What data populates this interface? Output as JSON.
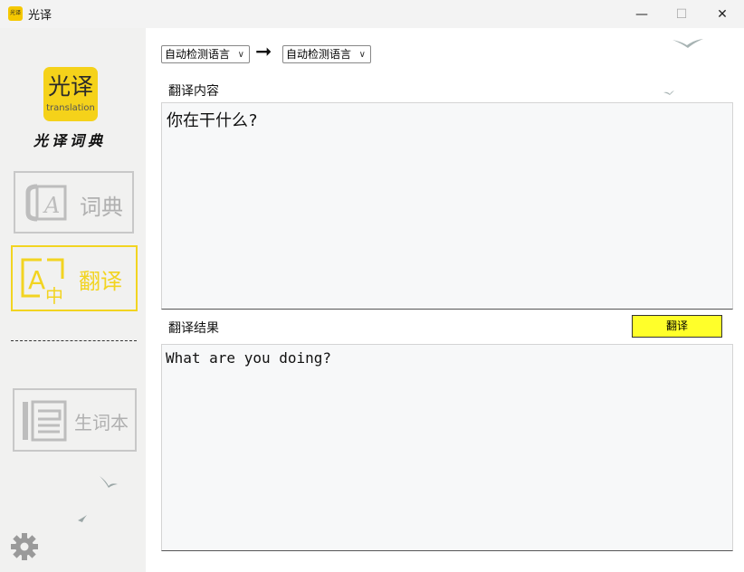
{
  "window": {
    "title": "光译",
    "app_icon_text": "光译",
    "minimize": "—",
    "maximize": "☐",
    "close": "✕"
  },
  "sidebar": {
    "logo_text": "光译",
    "logo_subtext": "translation",
    "brand": "光译词典",
    "nav": [
      {
        "label": "词典",
        "icon": "dictionary-icon",
        "active": false
      },
      {
        "label": "翻译",
        "icon": "translate-icon",
        "active": true
      },
      {
        "label": "生词本",
        "icon": "vocabulary-book-icon",
        "active": false
      }
    ],
    "settings_icon": "gear-icon"
  },
  "main": {
    "source_lang": "自动检测语言",
    "target_lang": "自动检测语言",
    "arrow_icon": "arrow-right-icon",
    "input_label": "翻译内容",
    "input_text": "你在干什么?",
    "output_label": "翻译结果",
    "translate_button": "翻译",
    "output_text": "What are you doing?"
  },
  "colors": {
    "accent_yellow": "#f2d421",
    "button_yellow": "#ffff2a",
    "sidebar_bg": "#f1f1f0",
    "inactive_gray": "#b0b0b0"
  }
}
